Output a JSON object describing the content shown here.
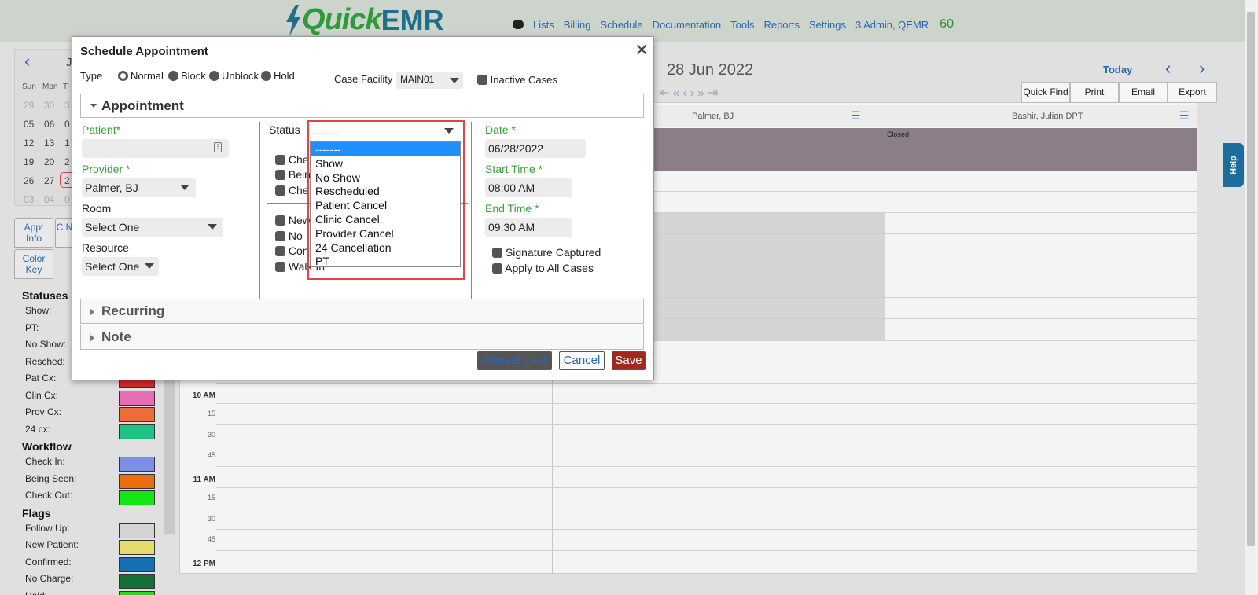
{
  "app": {
    "logo_quick": "QuickEMR"
  },
  "nav": {
    "items": [
      "Lists",
      "Billing",
      "Schedule",
      "Documentation",
      "Tools",
      "Reports",
      "Settings",
      "3 Admin, QEMR"
    ],
    "count": "60"
  },
  "minical": {
    "month_initial": "J",
    "dow": [
      "Sun",
      "Mon",
      "T"
    ],
    "weeks": [
      [
        "29",
        "30",
        "3"
      ],
      [
        "05",
        "06",
        "0"
      ],
      [
        "12",
        "13",
        "1"
      ],
      [
        "19",
        "20",
        "2"
      ],
      [
        "26",
        "27",
        "2"
      ],
      [
        "03",
        "04",
        "0"
      ]
    ]
  },
  "lefttabs": {
    "appt_info": "Appt Info",
    "clin_notes": "C N",
    "color_key": "Color Key"
  },
  "legend": {
    "statuses_title": "Statuses",
    "statuses": [
      {
        "label": "Show:",
        "color": "#f4f4f4"
      },
      {
        "label": "PT:",
        "color": "#f4f4f4"
      },
      {
        "label": "No Show:",
        "color": "#f4f4f4"
      },
      {
        "label": "Resched:",
        "color": "#f4f4f4"
      },
      {
        "label": "Pat Cx:",
        "color": "#d12a2a"
      },
      {
        "label": "Clin Cx:",
        "color": "#e46db3"
      },
      {
        "label": "Prov Cx:",
        "color": "#ec6c3c"
      },
      {
        "label": "24 cx:",
        "color": "#1fc484"
      }
    ],
    "workflow_title": "Workflow",
    "workflow": [
      {
        "label": "Check In:",
        "color": "#7b90e4"
      },
      {
        "label": "Being Seen:",
        "color": "#ec6c10"
      },
      {
        "label": "Check Out:",
        "color": "#14e814"
      }
    ],
    "flags_title": "Flags",
    "flags": [
      {
        "label": "Follow Up:",
        "color": "#d4d4d4"
      },
      {
        "label": "New Patient:",
        "color": "#e4dc6c"
      },
      {
        "label": "Confirmed:",
        "color": "#1470b0"
      },
      {
        "label": "No Charge:",
        "color": "#147034"
      },
      {
        "label": "Hold:",
        "color": "#14e814"
      }
    ]
  },
  "calendar": {
    "date": "28 Jun 2022",
    "today": "Today",
    "tools": [
      "Quick Find",
      "Print",
      "Email",
      "Export"
    ],
    "col1": "Palmer, BJ",
    "col2": "Bashir, Julian DPT",
    "closed": "Closed",
    "times": [
      {
        "h": "10 AM",
        "subs": [
          "15",
          "30",
          "45"
        ]
      },
      {
        "h": "11 AM",
        "subs": [
          "15",
          "30",
          "45"
        ]
      },
      {
        "h": "12 PM",
        "subs": []
      }
    ]
  },
  "help": "Help",
  "modal": {
    "title": "Schedule Appointment",
    "type_label": "Type",
    "types": [
      "Normal",
      "Block",
      "Unblock",
      "Hold"
    ],
    "case_facility_label": "Case Facility",
    "case_facility_value": "MAIN01",
    "inactive_cases": "Inactive Cases",
    "section_appointment": "Appointment",
    "patient_label": "Patient*",
    "patient_value": "",
    "provider_label": "Provider *",
    "provider_value": "Palmer, BJ",
    "room_label": "Room",
    "room_value": "Select One",
    "resource_label": "Resource",
    "resource_value": "Select One",
    "status_label": "Status",
    "status_value": "-------",
    "status_checks": [
      "Che",
      "Bein",
      "Che"
    ],
    "flag_checks": [
      "New",
      "No",
      "Con",
      "Walk In"
    ],
    "status_options": [
      "-------",
      "Show",
      "No Show",
      "Rescheduled",
      "Patient Cancel",
      "Clinic Cancel",
      "Provider Cancel",
      "24 Cancellation",
      "PT"
    ],
    "date_label": "Date *",
    "date_value": "06/28/2022",
    "start_label": "Start Time *",
    "start_value": "08:00 AM",
    "end_label": "End Time *",
    "end_value": "09:30 AM",
    "signature": "Signature Captured",
    "apply_all": "Apply to All Cases",
    "section_recurring": "Recurring",
    "section_note": "Note",
    "repeat_last": "Repeat Last",
    "cancel": "Cancel",
    "save": "Save"
  }
}
